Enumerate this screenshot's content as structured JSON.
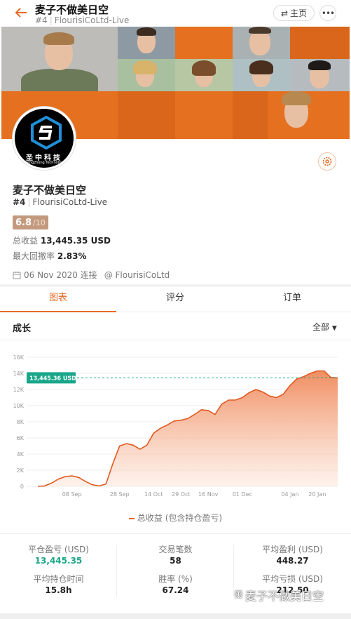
{
  "header": {
    "title": "麦子不做美日空",
    "rank": "#4",
    "account": "FlourisiCoLtd-Live",
    "home_label": "主页"
  },
  "profile": {
    "avatar_cn": "圣中科技",
    "avatar_en": "Shengzhong Technology",
    "name": "麦子不做美日空",
    "rank": "#4",
    "account": "FlourisiCoLtd-Live",
    "score": "6.8",
    "score_max": "/10",
    "total_profit_label": "总收益",
    "total_profit_value": "13,445.35 USD",
    "max_drawdown_label": "最大回撤率",
    "max_drawdown_value": "2.83%",
    "connected_date": "06 Nov 2020 连接",
    "broker": "@ FlourisiCoLtd"
  },
  "tabs": [
    {
      "label": "图表",
      "active": true
    },
    {
      "label": "评分",
      "active": false
    },
    {
      "label": "订单",
      "active": false
    }
  ],
  "section": {
    "title": "成长",
    "range_label": "全部"
  },
  "chart_data": {
    "type": "area",
    "title": "",
    "legend": "总收益 (包含持仓盈亏)",
    "current_value_label": "13,445.36 USD",
    "current_value": 13445.36,
    "y_ticks": [
      "0",
      "2K",
      "4K",
      "6K",
      "8K",
      "10K",
      "12K",
      "14K",
      "16K"
    ],
    "ylim": [
      0,
      16000
    ],
    "x_ticks": [
      "08 Sep",
      "28 Sep",
      "14 Oct",
      "29 Oct",
      "16 Nov",
      "01 Dec",
      "04 Jan",
      "20 Jan"
    ],
    "x": [
      "25 Aug",
      "28 Aug",
      "01 Sep",
      "04 Sep",
      "06 Sep",
      "08 Sep",
      "12 Sep",
      "16 Sep",
      "20 Sep",
      "23 Sep",
      "24 Sep",
      "26 Sep",
      "28 Sep",
      "01 Oct",
      "04 Oct",
      "08 Oct",
      "11 Oct",
      "14 Oct",
      "18 Oct",
      "22 Oct",
      "26 Oct",
      "29 Oct",
      "02 Nov",
      "07 Nov",
      "12 Nov",
      "16 Nov",
      "19 Nov",
      "23 Nov",
      "26 Nov",
      "29 Nov",
      "01 Dec",
      "05 Dec",
      "11 Dec",
      "17 Dec",
      "22 Dec",
      "27 Dec",
      "30 Dec",
      "04 Jan",
      "09 Jan",
      "13 Jan",
      "17 Jan",
      "20 Jan",
      "23 Jan",
      "26 Jan",
      "29 Jan"
    ],
    "y": [
      0,
      50,
      400,
      900,
      1200,
      1300,
      1100,
      600,
      200,
      50,
      300,
      2800,
      5000,
      5300,
      5100,
      4600,
      5100,
      6600,
      7200,
      7600,
      8100,
      8200,
      8400,
      8900,
      9500,
      9400,
      8900,
      10200,
      10700,
      10700,
      11000,
      11600,
      12000,
      11700,
      11200,
      11000,
      11400,
      12500,
      13300,
      13600,
      14000,
      14300,
      14300,
      13500,
      13445
    ]
  },
  "stats": [
    {
      "label": "平仓盈亏 (USD)",
      "value": "13,445.35",
      "accent": true
    },
    {
      "label": "交易笔数",
      "value": "58",
      "accent": false
    },
    {
      "label": "平均盈利 (USD)",
      "value": "448.27",
      "accent": false
    },
    {
      "label": "平均持仓时间",
      "value": "15.8h",
      "accent": false
    },
    {
      "label": "胜率 (%)",
      "value": "67.24",
      "accent": false
    },
    {
      "label": "平均亏损 (USD)",
      "value": "212.50",
      "accent": false
    }
  ],
  "watermark": "麦子不做美日空",
  "colors": {
    "accent": "#e56a26",
    "green": "#1aa68a",
    "banner_orange": "#e5701f"
  }
}
